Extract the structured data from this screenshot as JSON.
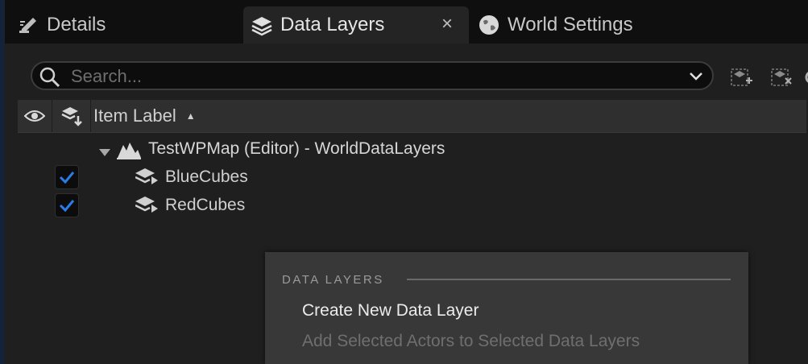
{
  "tabs": [
    {
      "label": "Details",
      "icon": "pencil-icon"
    },
    {
      "label": "Data Layers",
      "icon": "layers-icon",
      "close": "×"
    },
    {
      "label": "World Settings",
      "icon": "globe-icon"
    }
  ],
  "search": {
    "placeholder": "Search..."
  },
  "columns": {
    "visibility_icon": "eye-icon",
    "loaded_icon": "load-layers-icon",
    "label": "Item Label",
    "sort": "ascending"
  },
  "tree": {
    "root": {
      "label": "TestWPMap (Editor) - WorldDataLayers",
      "icon": "map-icon",
      "expanded": true
    },
    "children": [
      {
        "label": "BlueCubes",
        "checked": true,
        "icon": "data-layer-icon"
      },
      {
        "label": "RedCubes",
        "checked": true,
        "icon": "data-layer-icon"
      }
    ]
  },
  "context_menu": {
    "section_title": "DATA LAYERS",
    "items": [
      {
        "label": "Create New Data Layer",
        "enabled": true
      },
      {
        "label": "Add Selected Actors to Selected Data Layers",
        "enabled": false
      }
    ]
  },
  "colors": {
    "accent": "#2a7ce8",
    "background": "#1f1f1f",
    "header": "#2f2f2f",
    "menu": "#383838"
  }
}
